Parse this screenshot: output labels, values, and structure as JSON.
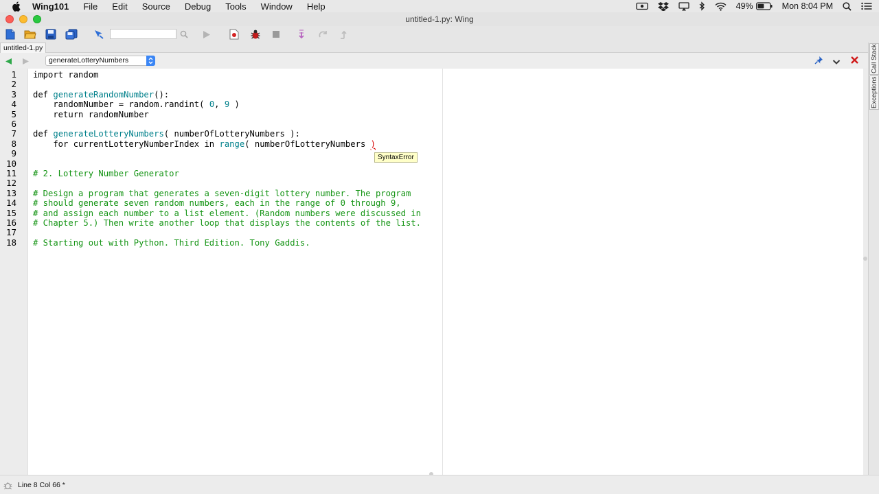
{
  "menubar": {
    "app": "Wing101",
    "items": [
      "File",
      "Edit",
      "Source",
      "Debug",
      "Tools",
      "Window",
      "Help"
    ],
    "battery": "49%",
    "clock": "Mon 8:04 PM"
  },
  "window": {
    "title": "untitled-1.py: Wing"
  },
  "toolbar": {
    "search_value": ""
  },
  "tabs": {
    "file": "untitled-1.py"
  },
  "navbar": {
    "scope": "generateLotteryNumbers"
  },
  "editor": {
    "line_numbers": [
      "1",
      "2",
      "3",
      "4",
      "5",
      "6",
      "7",
      "8",
      "9",
      "10",
      "11",
      "12",
      "13",
      "14",
      "15",
      "16",
      "17",
      "18"
    ],
    "l1_kw": "import",
    "l1_rest": " random",
    "l3_kw": "def ",
    "l3_fn": "generateRandomNumber",
    "l3_rest": "():",
    "l4_a": "    randomNumber = random.randint( ",
    "l4_n1": "0",
    "l4_b": ", ",
    "l4_n2": "9",
    "l4_c": " )",
    "l5": "    return randomNumber",
    "l7_kw": "def ",
    "l7_fn": "generateLotteryNumbers",
    "l7_rest": "( numberOfLotteryNumbers ):",
    "l8_a": "    for currentLotteryNumberIndex in ",
    "l8_bi": "range",
    "l8_b": "( numberOfLotteryNumbers ",
    "l8_err": ")",
    "l11": "# 2. Lottery Number Generator",
    "l13": "# Design a program that generates a seven-digit lottery number. The program",
    "l14": "# should generate seven random numbers, each in the range of 0 through 9,",
    "l15": "# and assign each number to a list element. (Random numbers were discussed in",
    "l16": "# Chapter 5.) Then write another loop that displays the contents of the list.",
    "l18": "# Starting out with Python. Third Edition. Tony Gaddis.",
    "tooltip": "SyntaxError"
  },
  "side_tabs": {
    "call_stack": "Call Stack",
    "exceptions": "Exceptions"
  },
  "status": {
    "text": "Line 8 Col 66 *"
  },
  "colors": {
    "keyword": "#000000",
    "function": "#00808b",
    "comment": "#149414",
    "error": "#d80000"
  }
}
